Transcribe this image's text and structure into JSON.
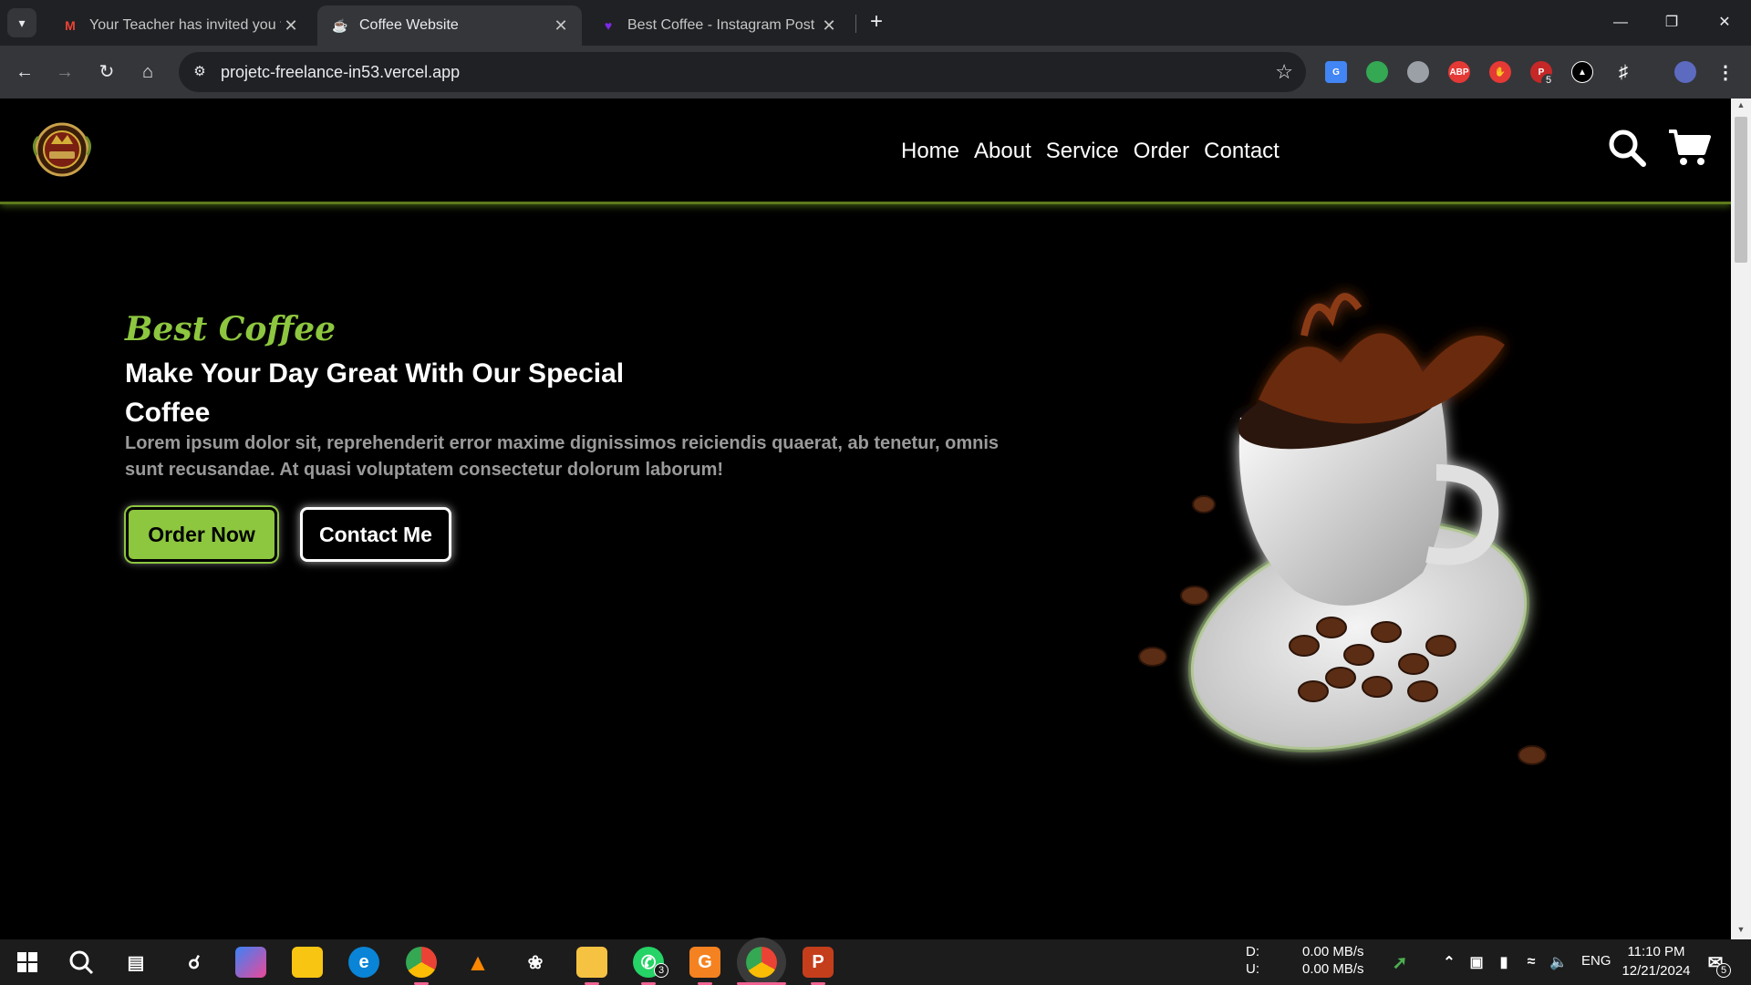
{
  "browser": {
    "tabs": [
      {
        "title": "Your Teacher has invited you to",
        "favicon": "gmail-icon",
        "active": false
      },
      {
        "title": "Coffee Website",
        "favicon": "coffee-favicon-icon",
        "active": true
      },
      {
        "title": "Best Coffee - Instagram Post - C",
        "favicon": "canva-icon",
        "active": false
      }
    ],
    "url": "projetc-freelance-in53.vercel.app",
    "extension_badge": "5"
  },
  "site": {
    "nav": [
      "Home",
      "About",
      "Service",
      "Order",
      "Contact"
    ],
    "hero": {
      "eyebrow": "Best Coffee",
      "title": "Make Your Day Great With Our Special Coffee",
      "text": "Lorem ipsum dolor sit, reprehenderit error maxime dignissimos reiciendis quaerat, ab tenetur, omnis sunt recusandae. At quasi voluptatem consectetur dolorum laborum!",
      "order_button": "Order Now",
      "contact_button": "Contact Me"
    },
    "colors": {
      "accent": "#8dc63f",
      "background": "#000000"
    }
  },
  "taskbar": {
    "net_label_d": "D:",
    "net_label_u": "U:",
    "net_down": "0.00 MB/s",
    "net_up": "0.00 MB/s",
    "language": "ENG",
    "time": "11:10 PM",
    "date": "12/21/2024",
    "whatsapp_badge": "3",
    "notification_badge": "5"
  }
}
